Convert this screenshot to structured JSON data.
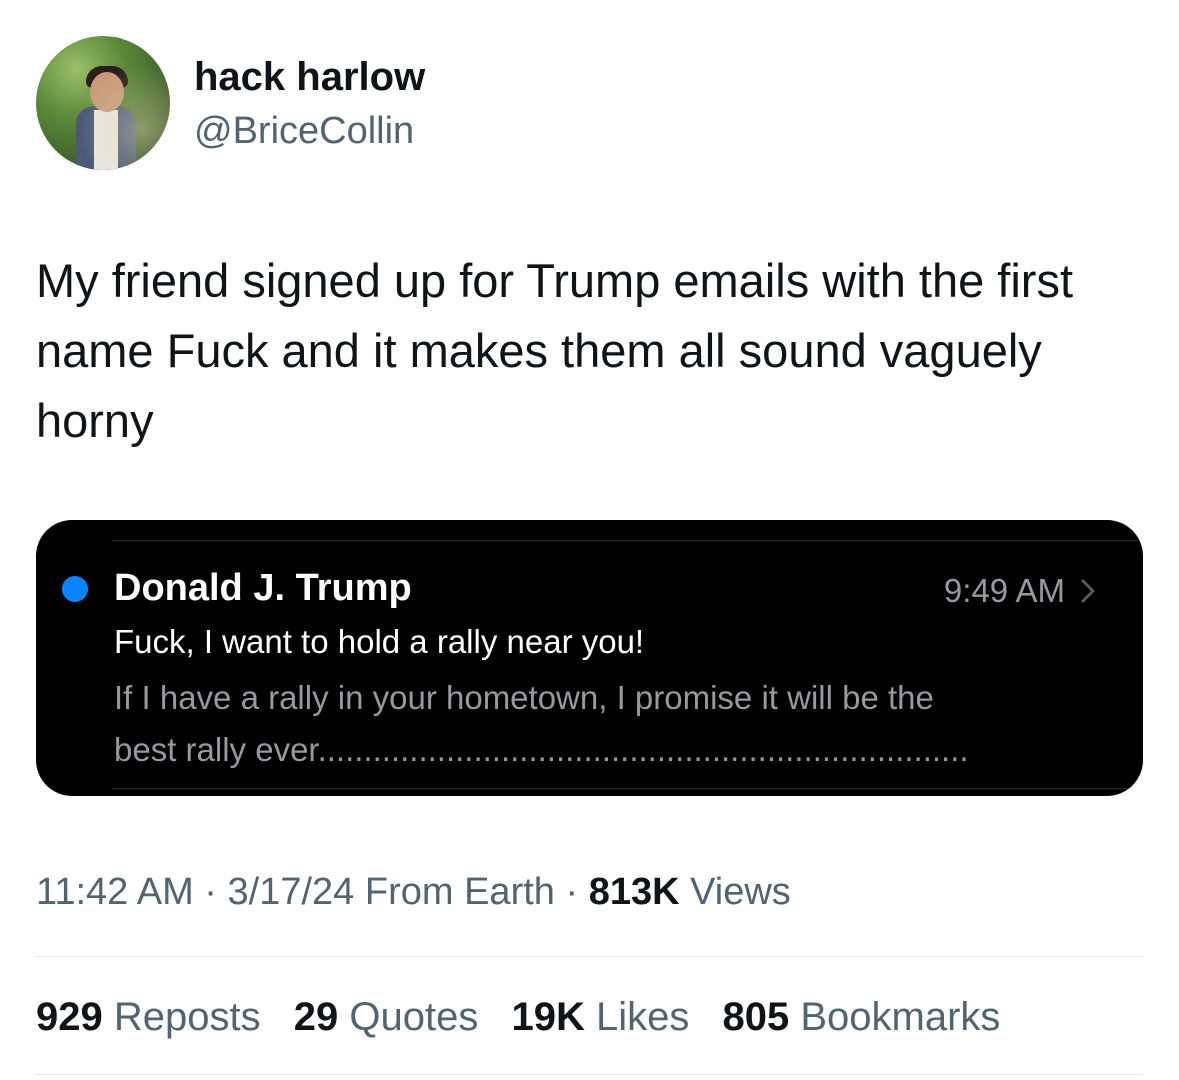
{
  "author": {
    "display_name": "hack harlow",
    "handle": "@BriceCollin"
  },
  "tweet": {
    "text": "My friend signed up for Trump emails with the first name Fuck and it makes them all sound vaguely horny"
  },
  "email": {
    "sender": "Donald J. Trump",
    "time": "9:49 AM",
    "subject": "Fuck, I want to hold a rally near you!",
    "preview_line1": "If I have a rally in your hometown, I promise it will be the",
    "preview_line2": "best rally ever.......................................................................",
    "unread_color": "#0a84ff"
  },
  "meta": {
    "time": "11:42 AM",
    "separator": "·",
    "date": "3/17/24",
    "source": "From Earth",
    "views_count": "813K",
    "views_label": "Views"
  },
  "stats": [
    {
      "count": "929",
      "label": "Reposts"
    },
    {
      "count": "29",
      "label": "Quotes"
    },
    {
      "count": "19K",
      "label": "Likes"
    },
    {
      "count": "805",
      "label": "Bookmarks"
    }
  ]
}
